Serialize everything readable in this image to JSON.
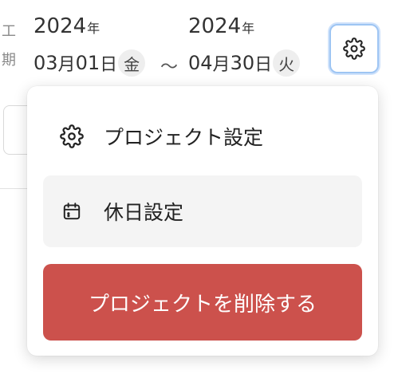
{
  "period": {
    "label_chars": [
      "工",
      "期"
    ]
  },
  "start": {
    "year": "2024",
    "year_unit": "年",
    "month": "03",
    "month_unit": "月",
    "day": "01",
    "day_unit": "日",
    "weekday": "金"
  },
  "end": {
    "year": "2024",
    "year_unit": "年",
    "month": "04",
    "month_unit": "月",
    "day": "30",
    "day_unit": "日",
    "weekday": "火"
  },
  "separator": "～",
  "settings_button": {
    "icon": "gear-icon"
  },
  "menu": {
    "items": [
      {
        "label": "プロジェクト設定",
        "icon": "gear-icon"
      },
      {
        "label": "休日設定",
        "icon": "calendar-icon"
      }
    ],
    "delete_label": "プロジェクトを削除する"
  },
  "colors": {
    "danger": "#cc514c",
    "focus_ring": "#9ec5f3",
    "hover_bg": "#f4f4f4"
  }
}
